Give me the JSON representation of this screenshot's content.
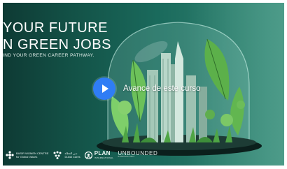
{
  "video": {
    "headline_line1": "YOUR FUTURE",
    "headline_line2": "N GREEN JOBS",
    "subheadline": "IND YOUR GREEN CAREER PATHWAY.",
    "title": "Avance de este curso",
    "play_icon": "play-icon"
  },
  "logos": {
    "logo1_line1": "BASIR WOMEN CENTRE",
    "logo1_line2": "for Global Values",
    "logo2_line1": "دبي العطاء",
    "logo2_line2": "Dubai Cares",
    "plan_name": "PLAN",
    "plan_sub": "INTERNATIONAL",
    "unbounded_name": "UNBOUNDED",
    "unbounded_sub": "ASSOCIATION"
  },
  "colors": {
    "play_button": "#2f7df5",
    "background": "#135247",
    "accent_green": "#7ecf6a"
  }
}
